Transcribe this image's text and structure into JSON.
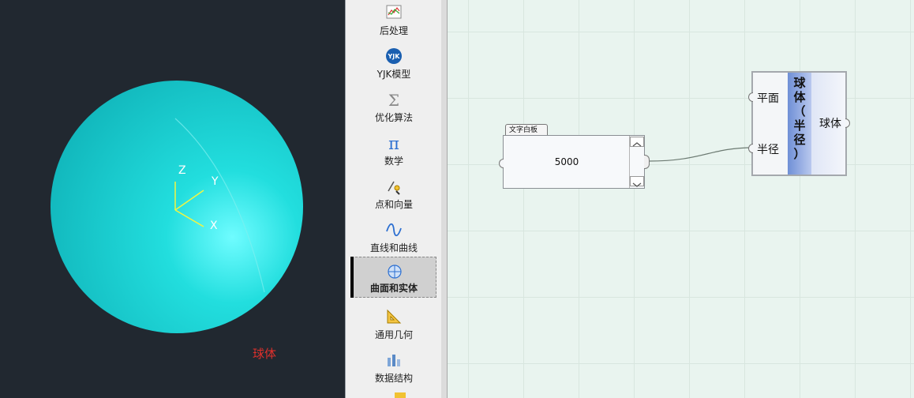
{
  "viewport": {
    "label": "球体",
    "axes": {
      "x": "X",
      "y": "Y",
      "z": "Z"
    },
    "colors": {
      "background": "#212830",
      "sphere": "#1fd6d6",
      "label": "#e0302c"
    }
  },
  "palette": {
    "items": [
      {
        "label": "后处理",
        "icon": "chart-line-icon"
      },
      {
        "label": "YJK模型",
        "icon": "yjk-logo-icon"
      },
      {
        "label": "优化算法",
        "icon": "sigma-icon"
      },
      {
        "label": "数学",
        "icon": "pi-icon"
      },
      {
        "label": "点和向量",
        "icon": "point-vector-icon"
      },
      {
        "label": "直线和曲线",
        "icon": "curve-icon"
      },
      {
        "label": "曲面和实体",
        "icon": "surface-solid-icon"
      },
      {
        "label": "通用几何",
        "icon": "triangle-ruler-icon"
      },
      {
        "label": "数据结构",
        "icon": "data-structure-icon"
      }
    ],
    "selected_label": "曲面和实体"
  },
  "canvas": {
    "text_panel": {
      "tab_label": "文字白板",
      "value": "5000"
    },
    "sphere_node": {
      "inputs": [
        "平面",
        "半径"
      ],
      "title": "球体（半径）",
      "title_chars": [
        "球",
        "体",
        "（",
        "半",
        "径",
        "）"
      ],
      "output": "球体"
    }
  }
}
